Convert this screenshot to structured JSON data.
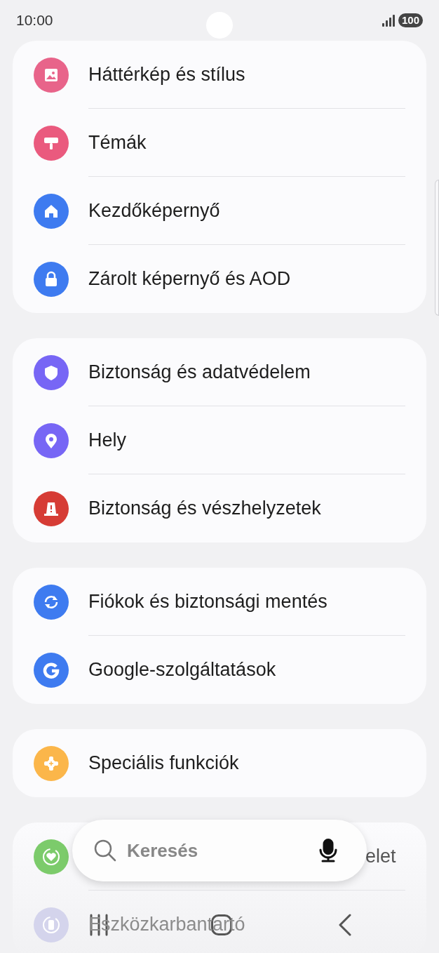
{
  "status_bar": {
    "time": "10:00",
    "battery": "100"
  },
  "groups": [
    {
      "items": [
        {
          "label": "Háttérkép és stílus",
          "color": "#e8648a"
        },
        {
          "label": "Témák",
          "color": "#ea5a7e"
        },
        {
          "label": "Kezdőképernyő",
          "color": "#3e7bf0"
        },
        {
          "label": "Zárolt képernyő és AOD",
          "color": "#3e7bf0"
        }
      ]
    },
    {
      "items": [
        {
          "label": "Biztonság és adatvédelem",
          "color": "#7766f5"
        },
        {
          "label": "Hely",
          "color": "#7766f5"
        },
        {
          "label": "Biztonság és vészhelyzetek",
          "color": "#d63c35"
        }
      ]
    },
    {
      "items": [
        {
          "label": "Fiókok és biztonsági mentés",
          "color": "#3e7bf0"
        },
        {
          "label": "Google-szolgáltatások",
          "color": "#3e7bf0"
        }
      ]
    },
    {
      "items": [
        {
          "label": "Speciális funkciók",
          "color": "#fbb64a"
        }
      ]
    },
    {
      "items": [
        {
          "label": "elet",
          "color": "#7ccb6b",
          "kind": "covered"
        },
        {
          "label": "Eszközkarbantartó",
          "color": "#d4d4ec",
          "kind": "faded"
        }
      ]
    }
  ],
  "search": {
    "placeholder": "Keresés"
  }
}
